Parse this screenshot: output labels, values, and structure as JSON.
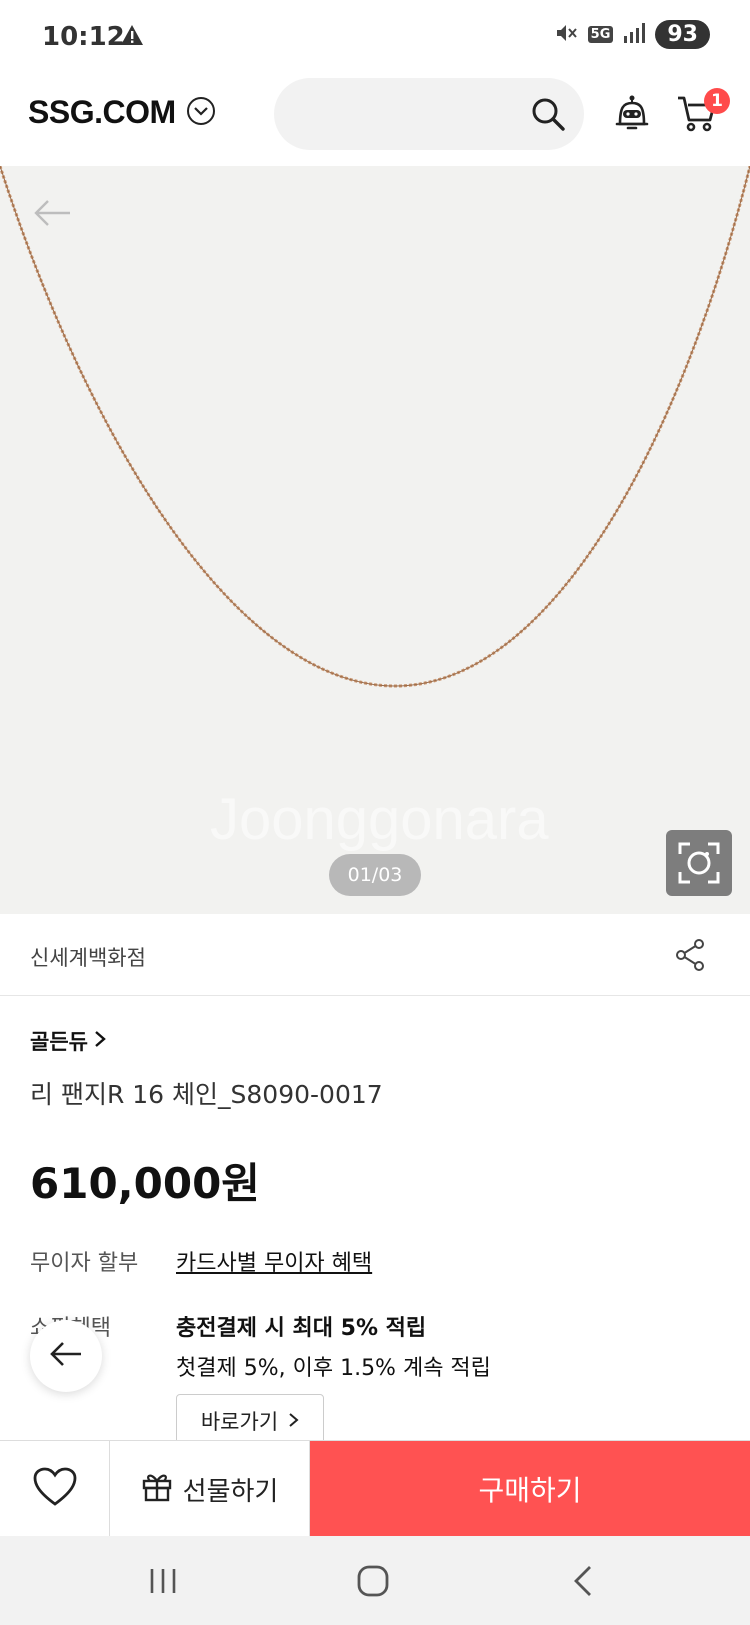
{
  "status_bar": {
    "time": "10:12",
    "network": "5G",
    "battery": "93"
  },
  "header": {
    "logo": "SSG.COM",
    "search_placeholder": "",
    "cart_count": "1"
  },
  "gallery": {
    "watermark": "Joonggonara",
    "pager": "01/03"
  },
  "seller": {
    "name": "신세계백화점"
  },
  "product": {
    "brand": "골든듀",
    "title": "리 팬지R 16 체인_S8090-0017",
    "price": "610,000원"
  },
  "benefits": {
    "installment_label": "무이자 할부",
    "installment_value": "카드사별 무이자 혜택",
    "shopping_label": "쇼핑혜택",
    "shopping_title": "충전결제 시 최대 5% 적립",
    "shopping_desc": "첫결제 5%, 이후 1.5% 계속 적립",
    "goto_label": "바로가기"
  },
  "action_bar": {
    "gift_label": "선물하기",
    "buy_label": "구매하기"
  },
  "colors": {
    "accent": "#ff5252",
    "badge": "#ff4b4b",
    "chain": "#b07a55"
  },
  "icons": [
    "warning-icon",
    "mute-icon",
    "signal-icon",
    "chevron-down-icon",
    "search-icon",
    "robot-bell-icon",
    "cart-icon",
    "back-arrow-icon",
    "lens-scan-icon",
    "share-icon",
    "chevron-right-icon",
    "heart-icon",
    "gift-icon",
    "recent-apps-icon",
    "home-icon",
    "back-nav-icon"
  ]
}
